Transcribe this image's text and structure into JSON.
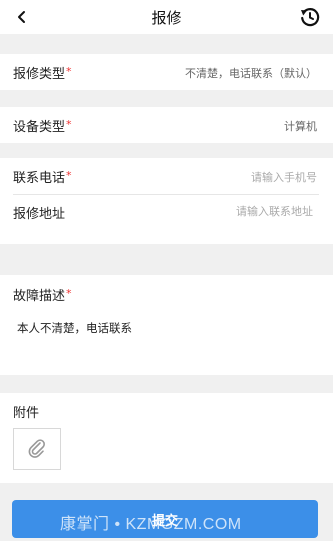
{
  "header": {
    "title": "报修",
    "back_icon": "chevron-left-icon",
    "history_icon": "history-icon"
  },
  "form": {
    "repair_type": {
      "label": "报修类型",
      "required_mark": "*",
      "value": "不清楚，电话联系（默认）"
    },
    "device_type": {
      "label": "设备类型",
      "required_mark": "*",
      "value": "计算机"
    },
    "phone": {
      "label": "联系电话",
      "required_mark": "*",
      "placeholder": "请输入手机号"
    },
    "address": {
      "label": "报修地址",
      "placeholder": "请输入联系地址"
    },
    "description": {
      "label": "故障描述",
      "required_mark": "*",
      "value": "本人不清楚，电话联系"
    },
    "attachment": {
      "label": "附件",
      "icon": "paperclip-icon"
    }
  },
  "submit": {
    "label": "提交",
    "color": "#3c8fe8"
  },
  "watermark": "康掌门 • KZMGZM.COM"
}
